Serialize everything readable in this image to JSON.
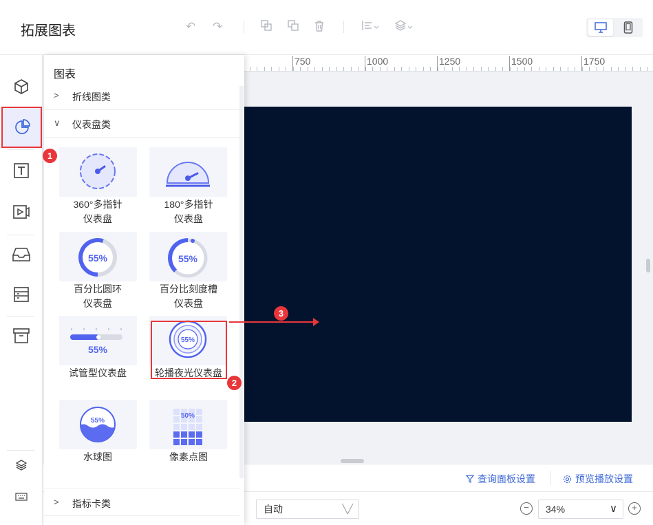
{
  "app": {
    "title": "拓展图表"
  },
  "toolbar": {
    "icons": [
      "undo-icon",
      "redo-icon",
      "copy-icon",
      "paste-icon",
      "delete-icon",
      "align-icon",
      "layers-icon"
    ]
  },
  "ruler": {
    "labels": [
      "750",
      "1000",
      "1250",
      "1500",
      "1750"
    ]
  },
  "panel": {
    "title": "图表",
    "categories": [
      {
        "label": "折线图类",
        "expanded": false
      },
      {
        "label": "仪表盘类",
        "expanded": true
      },
      {
        "label": "指标卡类",
        "expanded": false
      }
    ],
    "items": [
      {
        "line1": "360°多指针",
        "line2": "仪表盘"
      },
      {
        "line1": "180°多指针",
        "line2": "仪表盘"
      },
      {
        "line1": "百分比圆环",
        "line2": "仪表盘",
        "value": "55%"
      },
      {
        "line1": "百分比刻度槽",
        "line2": "仪表盘",
        "value": "55%"
      },
      {
        "line1": "试管型仪表盘",
        "value": "55%"
      },
      {
        "line1": "轮播夜光仪表盘",
        "value": "55%"
      },
      {
        "line1": "水球图",
        "value": "55%"
      },
      {
        "line1": "像素点图",
        "value": "50%"
      }
    ]
  },
  "badges": [
    "1",
    "2",
    "3"
  ],
  "bottombar": {
    "query_panel": "查询面板设置",
    "preview_play": "预览播放设置"
  },
  "footer": {
    "scale_mode": "自动",
    "zoom": "34%"
  },
  "colors": {
    "accent": "#3f6ad8",
    "highlight": "#e8363a",
    "canvas": "#03132d",
    "gauge": "#5b6cf0"
  }
}
